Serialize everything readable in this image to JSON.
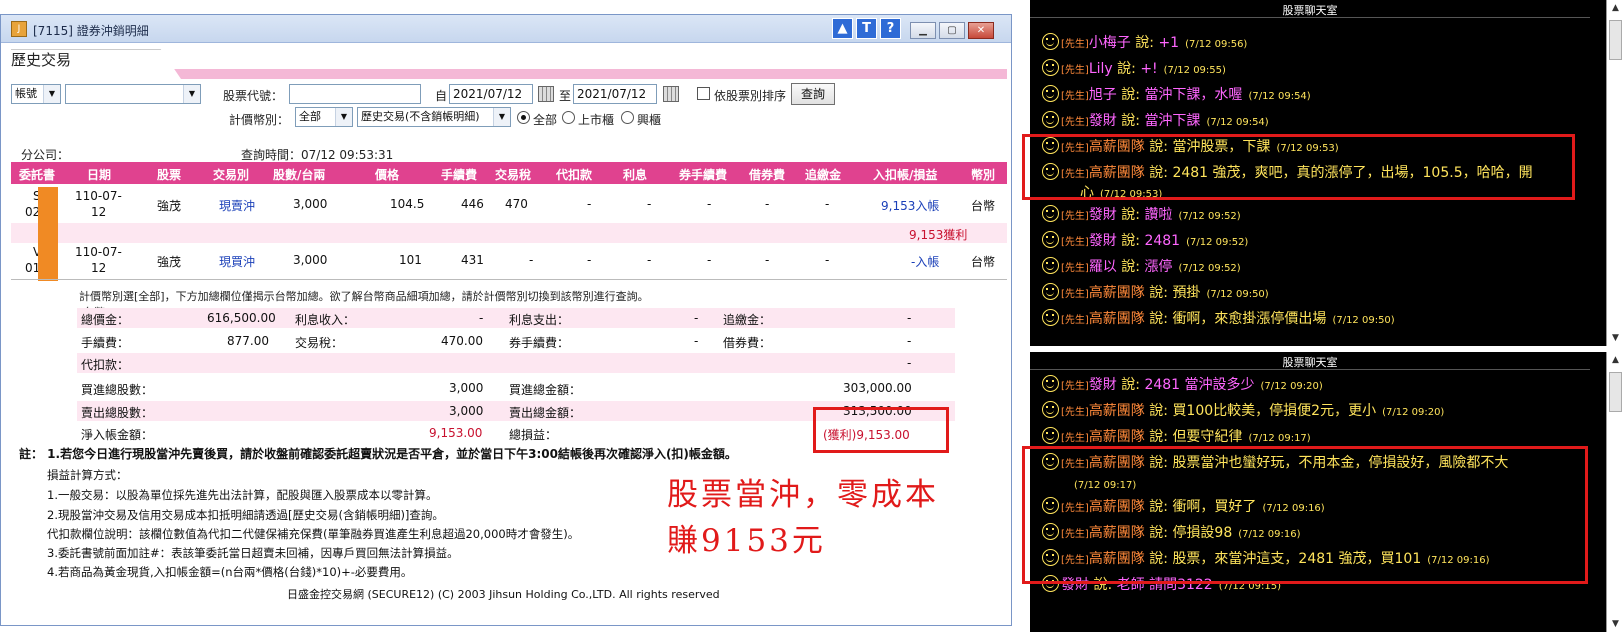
{
  "window": {
    "title": "[7115] 證券沖銷明細",
    "icon_label": "J",
    "help_buttons": [
      "▲",
      "T",
      "?"
    ],
    "win_buttons": [
      "▁",
      "▢",
      "✕"
    ]
  },
  "section": {
    "title": "歷史交易"
  },
  "form": {
    "account_type": "帳號",
    "account_value": "",
    "stock_code_label": "股票代號：",
    "stock_code_value": "",
    "date_from_prefix": "自",
    "date_from": "2021/07/12",
    "date_to_prefix": "至",
    "date_to": "2021/07/12",
    "sort_by_stock_label": "依股票別排序",
    "query_button": "查詢",
    "currency_label": "計價幣別：",
    "currency_value": "全部",
    "history_type_value": "歷史交易(不含銷帳明細)",
    "market_options": [
      "全部",
      "上市櫃",
      "興櫃"
    ],
    "market_selected": "全部"
  },
  "info": {
    "branch_label": "分公司：",
    "query_time": "查詢時間：07/12 09:53:31"
  },
  "table": {
    "headers": [
      "委託書",
      "日期",
      "股票",
      "交易別",
      "股數/台兩",
      "價格",
      "手續費",
      "交易稅",
      "代扣款",
      "利息",
      "券手續費",
      "借券費",
      "追繳金",
      "入扣帳/損益",
      "幣別"
    ],
    "rows": [
      {
        "order_prefix": "S",
        "order_suffix": "02",
        "date_l1": "110-07-",
        "date_l2": "12",
        "stock": "強茂",
        "type": "現賣沖",
        "shares": "3,000",
        "price": "104.5",
        "fee": "446",
        "tax": "470",
        "withhold": "-",
        "interest": "-",
        "lend_fee": "-",
        "borrow_fee": "-",
        "margin_call": "-",
        "amount": "9,153入帳",
        "currency": "台幣"
      },
      {
        "order_prefix": "V",
        "order_suffix": "01",
        "date_l1": "110-07-",
        "date_l2": "12",
        "stock": "強茂",
        "type": "現買沖",
        "shares": "3,000",
        "price": "101",
        "fee": "431",
        "tax": "-",
        "withhold": "-",
        "interest": "-",
        "lend_fee": "-",
        "borrow_fee": "-",
        "margin_call": "-",
        "amount": "-入帳",
        "currency": "台幣"
      }
    ],
    "profit_row": "9,153獲利"
  },
  "summary": {
    "note1": "計價幣別選[全部]，下方加總欄位僅揭示台幣加總。欲了解台幣商品細項加總，請於計價幣別切換到該幣別進行查詢。",
    "note2": "台幣：",
    "lines": [
      [
        {
          "label": "總價金：",
          "value": "616,500.00"
        },
        {
          "label": "利息收入：",
          "value": "-"
        },
        {
          "label": "利息支出：",
          "value": "-"
        },
        {
          "label": "追繳金：",
          "value": "-"
        }
      ],
      [
        {
          "label": "手續費：",
          "value": "877.00"
        },
        {
          "label": "交易稅：",
          "value": "470.00"
        },
        {
          "label": "券手續費：",
          "value": "-"
        },
        {
          "label": "借券費：",
          "value": "-"
        }
      ],
      [
        {
          "label": "代扣款：",
          "value": ""
        },
        {
          "label": "",
          "value": ""
        },
        {
          "label": "",
          "value": ""
        },
        {
          "label": "",
          "value": "-"
        }
      ]
    ],
    "buy_shares_label": "買進總股數：",
    "buy_shares": "3,000",
    "buy_amount_label": "買進總金額：",
    "buy_amount": "303,000.00",
    "sell_shares_label": "賣出總股數：",
    "sell_shares": "3,000",
    "sell_amount_label": "賣出總金額：",
    "sell_amount": "313,500.00",
    "net_label": "淨入帳金額：",
    "net_value": "9,153.00",
    "pnl_label": "總損益：",
    "pnl_value": "(獲利)9,153.00"
  },
  "footnotes": {
    "bold": "註： 1.若您今日進行現股當沖先賣後買，請於收盤前確認委託超賣狀況是否平倉，並於當日下午3:00結帳後再次確認淨入(扣)帳金額。",
    "lines": [
      "損益計算方式：",
      "1.一般交易：以股為單位採先進先出法計算，配股與匯入股票成本以零計算。",
      "2.現股當沖交易及信用交易成本扣抵明細請透過[歷史交易(含銷帳明細)]查詢。",
      "代扣款欄位說明：該欄位數值為代扣二代健保補充保費(單筆融券買進產生利息超過20,000時才會發生)。",
      "3.委託書號前面加註#：表該筆委託當日超賣未回補，因專戶買回無法計算損益。",
      "4.若商品為黃金現貨,入扣帳金額=(n台兩*價格(台錢)*10)+-必要費用。"
    ],
    "copyright": "日盛金控交易網 (SECURE12) (C) 2003 Jihsun Holding Co.,LTD. All rights reserved"
  },
  "callout": {
    "line1": "股票當沖，零成本",
    "line2": "賺9153元"
  },
  "chat1": {
    "title": "股票聊天室",
    "messages": [
      {
        "tag": "[先生]",
        "who": "小梅子",
        "said": "說:",
        "text": "+1",
        "ts": "(7/12 09:56)",
        "hi": false
      },
      {
        "tag": "[先生]",
        "who": "Lily",
        "said": "說:",
        "text": "+!",
        "ts": "(7/12 09:55)",
        "hi": false
      },
      {
        "tag": "[先生]",
        "who": "旭子",
        "said": "說:",
        "text": "當沖下課，水喔",
        "ts": "(7/12 09:54)",
        "hi": false
      },
      {
        "tag": "[先生]",
        "who": "發財",
        "said": "說:",
        "text": "當沖下課",
        "ts": "(7/12 09:54)",
        "hi": false
      },
      {
        "tag": "[先生]",
        "who": "高薪團隊",
        "said": "說:",
        "text": "當沖股票，下課",
        "ts": "(7/12 09:53)",
        "hi": true
      },
      {
        "tag": "[先生]",
        "who": "高薪團隊",
        "said": "說:",
        "text": "2481 強茂，爽吧，真的漲停了，出場，105.5，哈哈，開",
        "ts": "",
        "hi": true
      },
      {
        "tag": "[先生]",
        "who": "發財",
        "said": "說:",
        "text": "讚啦",
        "ts": "(7/12 09:52)",
        "hi": false
      },
      {
        "tag": "[先生]",
        "who": "發財",
        "said": "說:",
        "text": "2481",
        "ts": "(7/12 09:52)",
        "hi": false
      },
      {
        "tag": "[先生]",
        "who": "羅以",
        "said": "說:",
        "text": "漲停",
        "ts": "(7/12 09:52)",
        "hi": false
      },
      {
        "tag": "[先生]",
        "who": "高薪團隊",
        "said": "說:",
        "text": "預掛",
        "ts": "(7/12 09:50)",
        "hi": true
      },
      {
        "tag": "[先生]",
        "who": "高薪團隊",
        "said": "說:",
        "text": "衝啊，來愈掛漲停價出場",
        "ts": "(7/12 09:50)",
        "hi": true
      }
    ]
  },
  "chat2": {
    "title": "股票聊天室",
    "messages": [
      {
        "tag": "[先生]",
        "who": "發財",
        "said": "說:",
        "text": "2481 當沖設多少",
        "ts": "(7/12 09:20)",
        "hi": false
      },
      {
        "tag": "[先生]",
        "who": "高薪團隊",
        "said": "說:",
        "text": "買100比較美，停損便2元，更小",
        "ts": "(7/12 09:20)",
        "hi": true
      },
      {
        "tag": "[先生]",
        "who": "高薪團隊",
        "said": "說:",
        "text": "但要守紀律",
        "ts": "(7/12 09:17)",
        "hi": true
      },
      {
        "tag": "[先生]",
        "who": "高薪團隊",
        "said": "說:",
        "text": "股票當沖也蠻好玩，不用本金，停損設好，風險都不大",
        "ts": "",
        "hi": true
      },
      {
        "tag": "[先生]",
        "who": "高薪團隊",
        "said": "說:",
        "text": "衝啊，買好了",
        "ts": "(7/12 09:16)",
        "hi": true
      },
      {
        "tag": "[先生]",
        "who": "高薪團隊",
        "said": "說:",
        "text": "停損設98",
        "ts": "(7/12 09:16)",
        "hi": true
      },
      {
        "tag": "[先生]",
        "who": "高薪團隊",
        "said": "說:",
        "text": "股票，來當沖這支，2481 強茂，買101",
        "ts": "(7/12 09:16)",
        "hi": true
      },
      {
        "tag": "",
        "who": "發財",
        "said": "說:",
        "text": "老師 請問3122",
        "ts": "(7/12 09:15)",
        "hi": false
      }
    ]
  },
  "chat_continuation": {
    "chat1_wrap": "心",
    "chat1_wrap_ts": "(7/12 09:53)",
    "chat2_wrap_ts": "(7/12 09:17)"
  }
}
